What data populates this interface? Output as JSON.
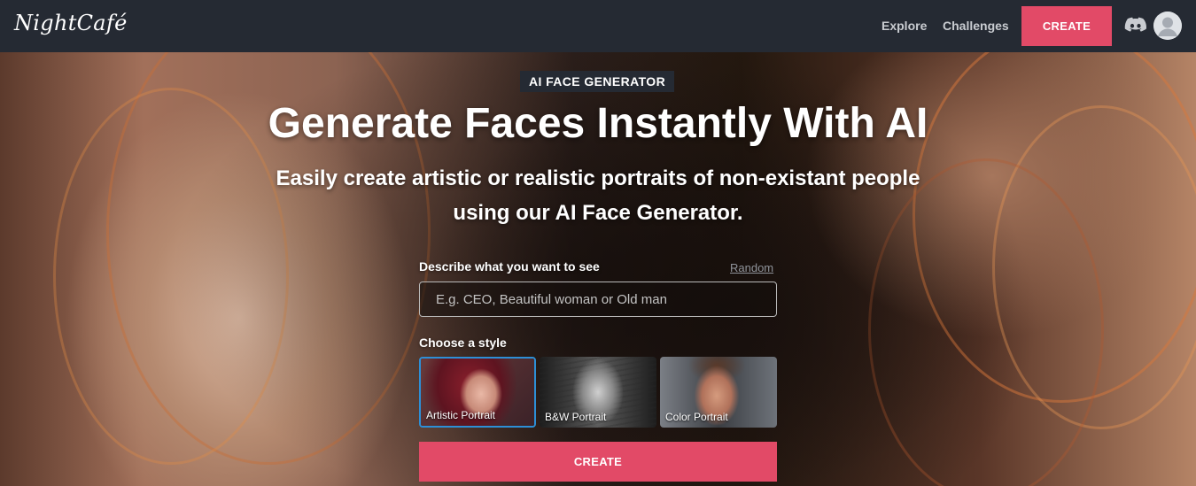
{
  "nav": {
    "logo": "NightCafé",
    "links": [
      "Explore",
      "Challenges"
    ],
    "create_label": "CREATE"
  },
  "hero": {
    "badge": "AI FACE GENERATOR",
    "title": "Generate Faces Instantly With AI",
    "subtitle": "Easily create artistic or realistic portraits of non-existant people using our AI Face Generator."
  },
  "form": {
    "describe_label": "Describe what you want to see",
    "random_label": "Random",
    "prompt_placeholder": "E.g. CEO, Beautiful woman or Old man",
    "prompt_value": "",
    "style_label": "Choose a style",
    "styles": [
      {
        "label": "Artistic Portrait",
        "selected": true
      },
      {
        "label": "B&W Portrait",
        "selected": false
      },
      {
        "label": "Color Portrait",
        "selected": false
      }
    ],
    "create_label": "CREATE"
  },
  "colors": {
    "nav_bg": "#252a33",
    "accent": "#e24a67",
    "selected_border": "#2d8fd6"
  },
  "icons": [
    "discord-icon",
    "user-avatar-icon"
  ]
}
